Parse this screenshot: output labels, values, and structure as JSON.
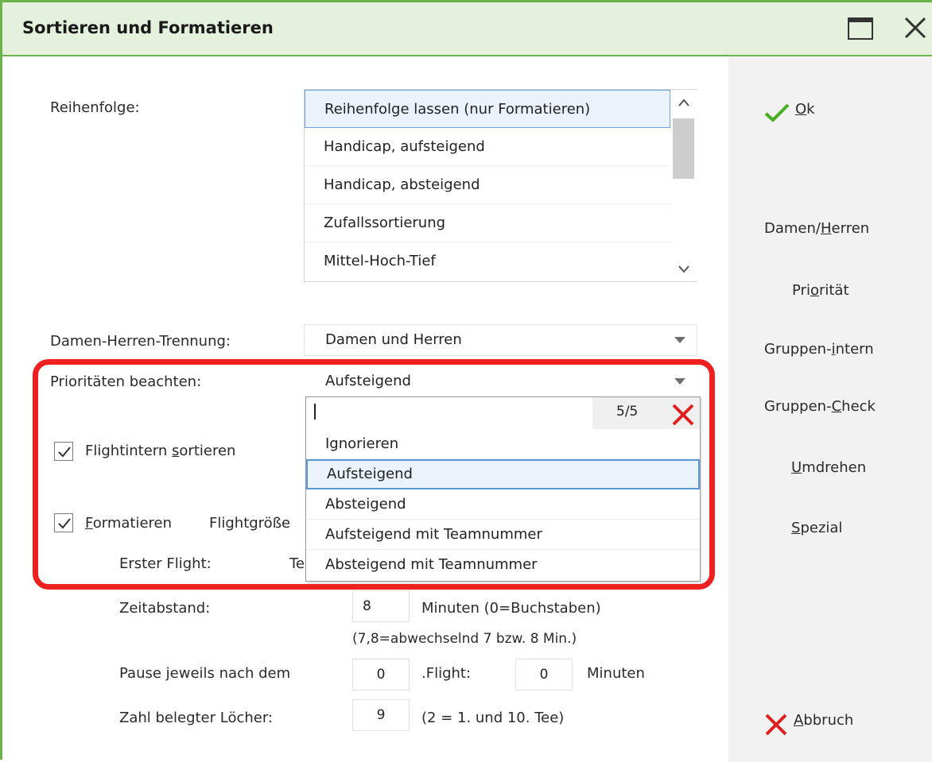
{
  "window": {
    "title": "Sortieren und Formatieren",
    "maximize_icon": "maximize-icon",
    "close_icon": "close-icon"
  },
  "reihenfolge": {
    "label": "Reihenfolge:",
    "items": [
      "Reihenfolge lassen (nur Formatieren)",
      "Handicap, aufsteigend",
      "Handicap, absteigend",
      "Zufallssortierung",
      "Mittel-Hoch-Tief"
    ],
    "selected": "Reihenfolge lassen (nur Formatieren)"
  },
  "damen_herren": {
    "label": "Damen-Herren-Trennung:",
    "value": "Damen und Herren"
  },
  "prioritaeten": {
    "label": "Prioritäten beachten:",
    "value": "Aufsteigend",
    "search_value": "",
    "count": "5/5",
    "options": [
      "Ignorieren",
      "Aufsteigend",
      "Absteigend",
      "Aufsteigend mit Teamnummer",
      "Absteigend mit Teamnummer"
    ],
    "selected": "Aufsteigend"
  },
  "flightintern": {
    "label_pre": "Flightintern ",
    "label_u": "s",
    "label_post": "ortieren",
    "checked": true
  },
  "formatieren": {
    "label_u": "F",
    "label_post": "ormatieren",
    "checked": true,
    "flightgroesse_label": "Flightgröße"
  },
  "erster_flight": {
    "label": "Erster Flight:",
    "partial": "Te"
  },
  "zeitabstand": {
    "label": "Zeitabstand:",
    "value": "8",
    "unit": "Minuten (0=Buchstaben)",
    "hint": "(7,8=abwechselnd 7 bzw. 8 Min.)"
  },
  "pause": {
    "label": "Pause jeweils nach dem",
    "flight_value": "0",
    "flight_label": ".Flight:",
    "minutes_value": "0",
    "minutes_label": "Minuten"
  },
  "loecher": {
    "label": "Zahl belegter Löcher:",
    "value": "9",
    "hint": "(2 = 1. und 10. Tee)"
  },
  "buttons": {
    "ok": {
      "u": "O",
      "rest": "k"
    },
    "damen_herren": {
      "pre": "Damen/",
      "u": "H",
      "post": "erren"
    },
    "prioritaet": {
      "pre": "Pri",
      "u": "o",
      "post": "rität"
    },
    "gruppen_intern": {
      "pre": "Gruppen-",
      "u": "i",
      "post": "ntern"
    },
    "gruppen_check": {
      "pre": "Gruppen-",
      "u": "C",
      "post": "heck"
    },
    "umdrehen": {
      "u": "U",
      "post": "mdrehen"
    },
    "spezial": {
      "u": "S",
      "post": "pezial"
    },
    "abbruch": {
      "u": "A",
      "post": "bbruch"
    }
  },
  "colors": {
    "accent": "#6cb34a",
    "title_bg": "#e4f1dc",
    "highlight": "#ef2020",
    "selection_border": "#5d98d6"
  }
}
